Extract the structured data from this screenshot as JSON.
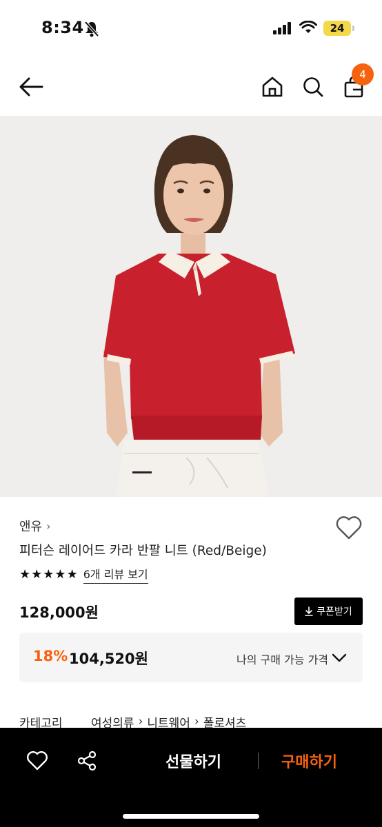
{
  "status_bar": {
    "time": "8:34",
    "battery": "24"
  },
  "nav": {
    "cart_count": "4"
  },
  "product": {
    "brand": "앤유",
    "brand_chevron": "›",
    "title": "피터슨 레이어드 카라 반팔 니트 (Red/Beige)",
    "rating": 5,
    "review_link": "6개 리뷰 보기",
    "original_price": "128,000원",
    "coupon_label": "쿠폰받기",
    "discount_rate": "18%",
    "sale_price": "104,520원",
    "price_label": "나의 구매 가능 가격"
  },
  "category": {
    "label": "카테고리",
    "path": [
      "여성의류",
      "니트웨어",
      "폴로셔츠"
    ]
  },
  "bottom_bar": {
    "gift_label": "선물하기",
    "buy_label": "구매하기"
  },
  "colors": {
    "accent": "#f7620f",
    "shirt_red": "#c8202c"
  }
}
